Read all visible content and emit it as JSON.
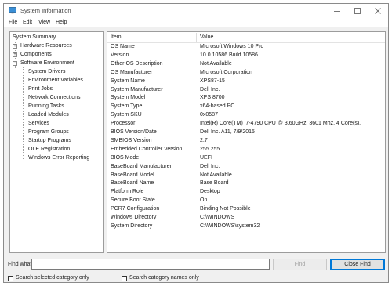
{
  "window": {
    "title": "System Information"
  },
  "menu": [
    "File",
    "Edit",
    "View",
    "Help"
  ],
  "tree": {
    "root": "System Summary",
    "items": [
      {
        "label": "Hardware Resources",
        "expander": "+"
      },
      {
        "label": "Components",
        "expander": "+"
      },
      {
        "label": "Software Environment",
        "expander": "−"
      }
    ],
    "children": [
      "System Drivers",
      "Environment Variables",
      "Print Jobs",
      "Network Connections",
      "Running Tasks",
      "Loaded Modules",
      "Services",
      "Program Groups",
      "Startup Programs",
      "OLE Registration",
      "Windows Error Reporting"
    ]
  },
  "table": {
    "headers": [
      "Item",
      "Value"
    ],
    "rows": [
      [
        "OS Name",
        "Microsoft Windows 10 Pro"
      ],
      [
        "Version",
        "10.0.10586 Build 10586"
      ],
      [
        "Other OS Description",
        "Not Available"
      ],
      [
        "OS Manufacturer",
        "Microsoft Corporation"
      ],
      [
        "System Name",
        "XPS87-15"
      ],
      [
        "System Manufacturer",
        "Dell Inc."
      ],
      [
        "System Model",
        "XPS 8700"
      ],
      [
        "System Type",
        "x64-based PC"
      ],
      [
        "System SKU",
        "0x0587"
      ],
      [
        "Processor",
        "Intel(R) Core(TM) i7-4790 CPU @ 3.60GHz, 3601 Mhz, 4 Core(s),"
      ],
      [
        "BIOS Version/Date",
        "Dell Inc. A11, 7/9/2015"
      ],
      [
        "SMBIOS Version",
        "2.7"
      ],
      [
        "Embedded Controller Version",
        "255.255"
      ],
      [
        "BIOS Mode",
        "UEFI"
      ],
      [
        "BaseBoard Manufacturer",
        "Dell Inc."
      ],
      [
        "BaseBoard Model",
        "Not Available"
      ],
      [
        "BaseBoard Name",
        "Base Board"
      ],
      [
        "Platform Role",
        "Desktop"
      ],
      [
        "Secure Boot State",
        "On"
      ],
      [
        "PCR7 Configuration",
        "Binding Not Possible"
      ],
      [
        "Windows Directory",
        "C:\\WINDOWS"
      ],
      [
        "System Directory",
        "C:\\WINDOWS\\system32"
      ]
    ]
  },
  "find": {
    "label": "Find what:",
    "value": "",
    "find_button": "Find",
    "close_button": "Close Find",
    "option_selected": "Search selected category only",
    "option_names": "Search category names only"
  },
  "colors": {
    "accent": "#0078d7",
    "window_bg": "#f0f0f0",
    "panel_bg": "#ffffff"
  }
}
